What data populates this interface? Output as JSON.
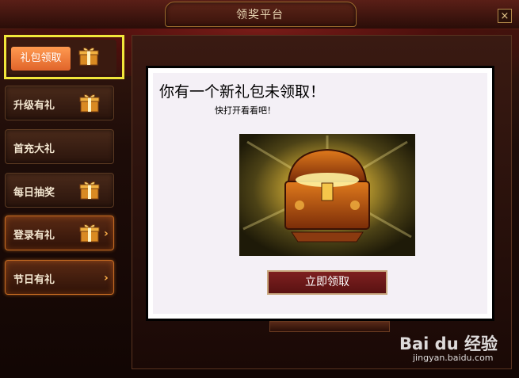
{
  "window": {
    "title": "领奖平台",
    "close_symbol": "×"
  },
  "sidebar": {
    "items": [
      {
        "label": "礼包领取",
        "selected": true,
        "icon": "gift-icon"
      },
      {
        "label": "升级有礼",
        "icon": "gift-icon"
      },
      {
        "label": "首充大礼"
      },
      {
        "label": "每日抽奖",
        "icon": "gift-icon"
      },
      {
        "label": "登录有礼",
        "icon": "gift-icon",
        "arrow": "›"
      },
      {
        "label": "节日有礼",
        "arrow": "›"
      }
    ]
  },
  "main": {
    "headline": "你有一个新礼包未领取！",
    "subline": "快打开看看吧！",
    "claim_button": "立即领取"
  },
  "watermark": {
    "brand": "Bai du 经验",
    "url": "jingyan.baidu.com"
  },
  "colors": {
    "accent_orange": "#e0642a",
    "highlight_yellow": "#f2e63a",
    "claim_red": "#7e2020"
  }
}
